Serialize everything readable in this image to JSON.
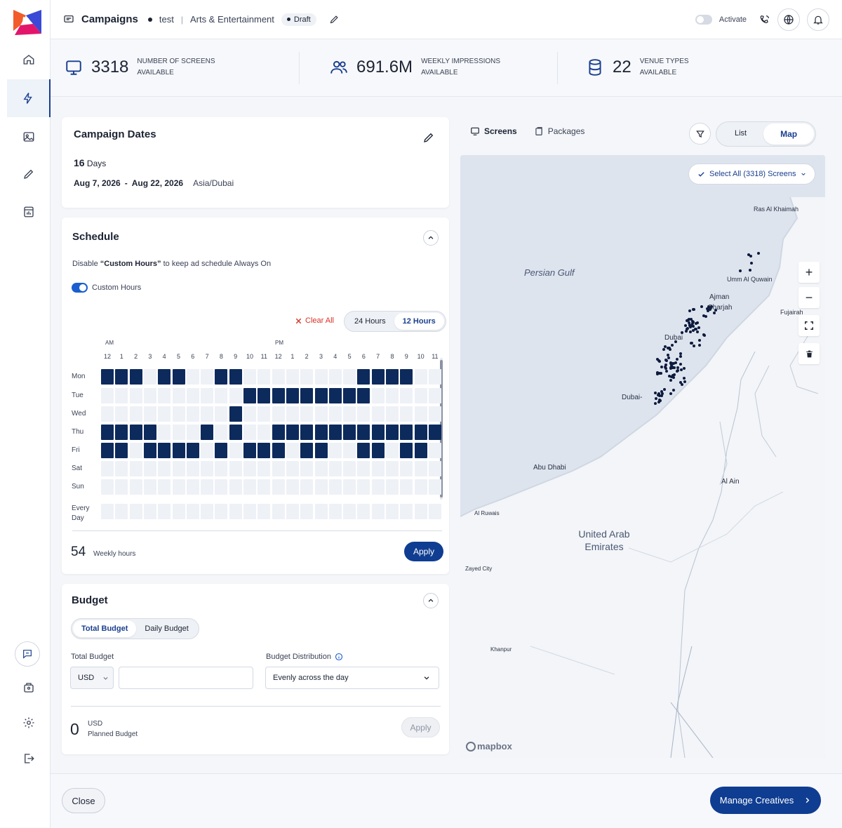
{
  "header": {
    "title": "Campaigns",
    "campaign_name": "test",
    "category": "Arts & Entertainment",
    "status": "Draft",
    "activate_label": "Activate"
  },
  "stats": [
    {
      "value": "3318",
      "label_line1": "NUMBER OF SCREENS",
      "label_line2": "AVAILABLE",
      "icon": "monitor-icon"
    },
    {
      "value": "691.6M",
      "label_line1": "WEEKLY IMPRESSIONS",
      "label_line2": "AVAILABLE",
      "icon": "people-icon"
    },
    {
      "value": "22",
      "label_line1": "VENUE TYPES",
      "label_line2": "AVAILABLE",
      "icon": "database-icon"
    }
  ],
  "campaign_dates": {
    "title": "Campaign Dates",
    "days_num": "16",
    "days_label": "Days",
    "start": "Aug 7, 2026",
    "dash": "-",
    "end": "Aug 22, 2026",
    "timezone": "Asia/Dubai"
  },
  "schedule": {
    "title": "Schedule",
    "hint_prefix": "Disable ",
    "hint_bold": "“Custom Hours”",
    "hint_suffix": " to keep ad schedule Always On",
    "toggle_label": "Custom Hours",
    "clear_all": "Clear All",
    "mode_24": "24 Hours",
    "mode_12": "12 Hours",
    "am": "AM",
    "pm": "PM",
    "hours": [
      "12",
      "1",
      "2",
      "3",
      "4",
      "5",
      "6",
      "7",
      "8",
      "9",
      "10",
      "11",
      "12",
      "1",
      "2",
      "3",
      "4",
      "5",
      "6",
      "7",
      "8",
      "9",
      "10",
      "11"
    ],
    "days": [
      "Mon",
      "Tue",
      "Wed",
      "Thu",
      "Fri",
      "Sat",
      "Sun"
    ],
    "every_day_line1": "Every",
    "every_day_line2": "Day",
    "weekly_hours": "54",
    "weekly_hours_label": "Weekly hours",
    "apply": "Apply",
    "grid": [
      [
        1,
        1,
        1,
        0,
        1,
        1,
        0,
        0,
        1,
        1,
        0,
        0,
        0,
        0,
        0,
        0,
        0,
        0,
        1,
        1,
        1,
        1,
        0,
        0
      ],
      [
        0,
        0,
        0,
        0,
        0,
        0,
        0,
        0,
        0,
        0,
        1,
        1,
        1,
        1,
        1,
        1,
        1,
        1,
        1,
        0,
        0,
        0,
        0,
        0
      ],
      [
        0,
        0,
        0,
        0,
        0,
        0,
        0,
        0,
        0,
        1,
        0,
        0,
        0,
        0,
        0,
        0,
        0,
        0,
        0,
        0,
        0,
        0,
        0,
        0
      ],
      [
        1,
        1,
        1,
        1,
        0,
        0,
        0,
        1,
        0,
        1,
        0,
        0,
        1,
        1,
        1,
        1,
        1,
        1,
        1,
        1,
        1,
        1,
        1,
        1
      ],
      [
        1,
        1,
        0,
        1,
        1,
        1,
        1,
        0,
        1,
        0,
        1,
        1,
        1,
        0,
        1,
        1,
        0,
        0,
        1,
        1,
        0,
        1,
        1,
        0
      ],
      [
        0,
        0,
        0,
        0,
        0,
        0,
        0,
        0,
        0,
        0,
        0,
        0,
        0,
        0,
        0,
        0,
        0,
        0,
        0,
        0,
        0,
        0,
        0,
        0
      ],
      [
        0,
        0,
        0,
        0,
        0,
        0,
        0,
        0,
        0,
        0,
        0,
        0,
        0,
        0,
        0,
        0,
        0,
        0,
        0,
        0,
        0,
        0,
        0,
        0
      ],
      [
        0,
        0,
        0,
        0,
        0,
        0,
        0,
        0,
        0,
        0,
        0,
        0,
        0,
        0,
        0,
        0,
        0,
        0,
        0,
        0,
        0,
        0,
        0,
        0
      ]
    ]
  },
  "budget": {
    "title": "Budget",
    "tab_total": "Total Budget",
    "tab_daily": "Daily Budget",
    "total_label": "Total Budget",
    "currency": "USD",
    "amount_placeholder": "",
    "distribution_label": "Budget Distribution",
    "distribution_value": "Evenly across the day",
    "planned_value": "0",
    "planned_currency": "USD",
    "planned_label": "Planned Budget",
    "apply": "Apply"
  },
  "map": {
    "tab_screens": "Screens",
    "tab_packages": "Packages",
    "view_list": "List",
    "view_map": "Map",
    "select_all": "Select All (3318) Screens",
    "labels": {
      "persian_gulf": "Persian Gulf",
      "ras_al_khaimah": "Ras Al Khaimah",
      "umm_al_quwain": "Umm Al Quwain",
      "ajman": "Ajman",
      "sharjah": "Sharjah",
      "fujairah": "Fujairah",
      "dubai": "Dubai",
      "dubai2": "Dubai-",
      "abu_dhabi": "Abu Dhabi",
      "al_ain": "Al Ain",
      "al_ruwais": "Al Ruwais",
      "uae_line1": "United Arab",
      "uae_line2": "Emirates",
      "zayed_city": "Zayed City",
      "khanpur": "Khanpur",
      "mapbox": "mapbox"
    }
  },
  "footer": {
    "close": "Close",
    "manage": "Manage Creatives"
  },
  "colors": {
    "primary": "#0f3d91",
    "cell_on": "#0d2a5c",
    "clear": "#d93025"
  }
}
